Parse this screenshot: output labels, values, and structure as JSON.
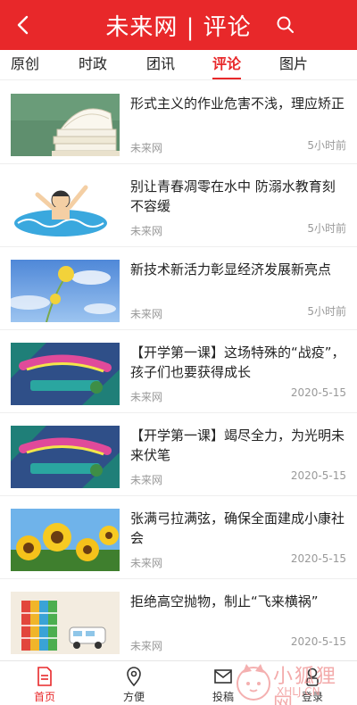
{
  "header": {
    "title": "未来网 | 评论",
    "back_icon": "chevron-left-icon",
    "search_icon": "search-icon",
    "background": "#e8282a"
  },
  "tabs": [
    {
      "label": "原创",
      "active": false
    },
    {
      "label": "时政",
      "active": false
    },
    {
      "label": "团讯",
      "active": false
    },
    {
      "label": "评论",
      "active": true
    },
    {
      "label": "图片",
      "active": false
    }
  ],
  "articles": [
    {
      "title": "形式主义的作业危害不浅，理应矫正",
      "source": "未来网",
      "time": "5小时前",
      "thumb": "books"
    },
    {
      "title": "别让青春凋零在水中 防溺水教育刻不容缓",
      "source": "未来网",
      "time": "5小时前",
      "thumb": "drowning"
    },
    {
      "title": "新技术新活力彰显经济发展新亮点",
      "source": "未来网",
      "time": "5小时前",
      "thumb": "dandelion"
    },
    {
      "title": "【开学第一课】这场特殊的“战疫”，孩子们也要获得成长",
      "source": "未来网",
      "time": "2020-5-15",
      "thumb": "lesson"
    },
    {
      "title": "【开学第一课】竭尽全力，为光明未来伏笔",
      "source": "未来网",
      "time": "2020-5-15",
      "thumb": "lesson"
    },
    {
      "title": "张满弓拉满弦，确保全面建成小康社会",
      "source": "未来网",
      "time": "2020-5-15",
      "thumb": "sunflowers"
    },
    {
      "title": "拒绝高空抛物，制止“飞来横祸”",
      "source": "未来网",
      "time": "2020-5-15",
      "thumb": "blocks"
    }
  ],
  "bottom_nav": [
    {
      "label": "首页",
      "icon": "home-doc-icon",
      "active": true
    },
    {
      "label": "方便",
      "icon": "location-pin-icon",
      "active": false
    },
    {
      "label": "投稿",
      "icon": "envelope-icon",
      "active": false
    },
    {
      "label": "登录",
      "icon": "user-icon",
      "active": false
    }
  ],
  "watermark": {
    "text": "小狐狸网",
    "url": "XHLJ.CN"
  },
  "colors": {
    "accent": "#e8282a",
    "muted": "#999999"
  }
}
